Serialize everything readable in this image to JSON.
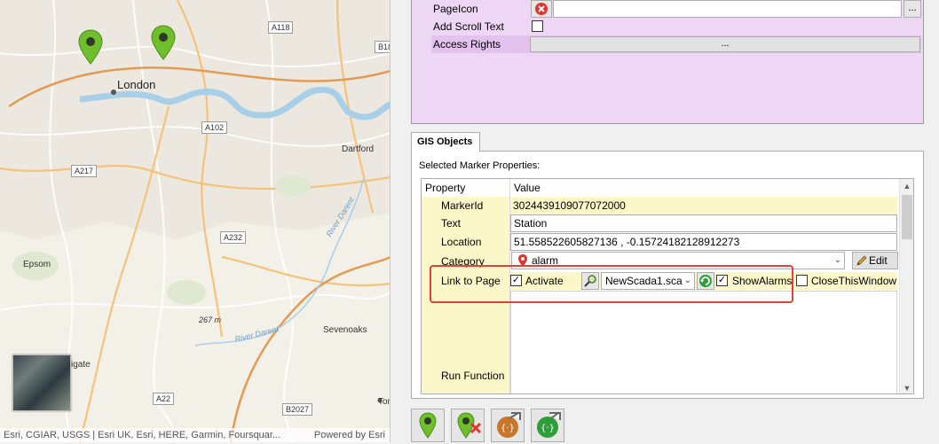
{
  "map": {
    "places": {
      "london": "London",
      "dartford": "Dartford",
      "epsom": "Epsom",
      "sevenoaks": "Sevenoaks",
      "gate": "igate",
      "ton": "Ton"
    },
    "roads": {
      "a118": "A118",
      "b18": "B18",
      "a102": "A102",
      "a217": "A217",
      "a232": "A232",
      "a22": "A22",
      "b2027": "B2027"
    },
    "rivers": {
      "darent": "River Darent",
      "darent2": "River Darent"
    },
    "spot_height": "267 m",
    "attribution": "Esri, CGIAR, USGS | Esri UK, Esri, HERE, Garmin, Foursquar...",
    "powered_by": "Powered by Esri",
    "colors": {
      "marker": "#6fbf2c",
      "water": "#a8cfe8",
      "land": "#f3f0e8"
    }
  },
  "top_panel": {
    "page_icon_label": "PageIcon",
    "add_scroll_text_label": "Add Scroll Text",
    "access_rights_label": "Access Rights",
    "dots": "...",
    "access_dots": "...",
    "add_scroll_text_checked": false,
    "background": "#eed6f5"
  },
  "gis": {
    "tab_label": "GIS Objects",
    "section_title": "Selected Marker Properties:",
    "header_property": "Property",
    "header_value": "Value",
    "rows": {
      "marker_id_label": "MarkerId",
      "marker_id_value": "3024439109077072000",
      "text_label": "Text",
      "text_value": "Station",
      "location_label": "Location",
      "location_value": "51.558522605827136 , -0.15724182128912273",
      "category_label": "Category",
      "category_value": "alarm",
      "edit_label": "Edit",
      "link_label": "Link to Page",
      "activate_label": "Activate",
      "page_value": "NewScada1.sca",
      "show_alarms_label": "ShowAlarms",
      "close_window_label": "CloseThisWindow",
      "run_function_label": "Run Function"
    },
    "activate_checked": true,
    "show_alarms_checked": true,
    "close_window_checked": false,
    "highlight_color": "#e0413b"
  },
  "toolbar": {
    "buttons": [
      "add-marker",
      "delete-marker",
      "export-script",
      "import-script"
    ]
  }
}
